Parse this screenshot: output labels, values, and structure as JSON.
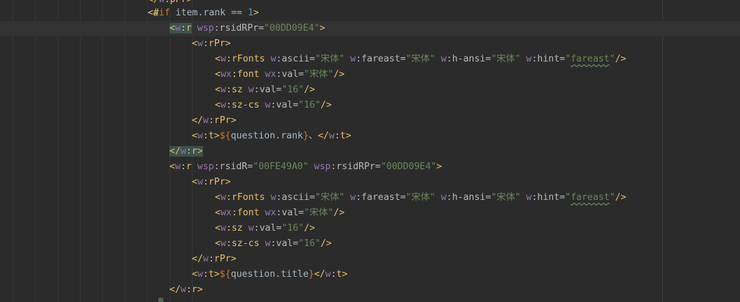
{
  "editor": {
    "lines": [
      {
        "tokens": [
          {
            "t": "</",
            "k": "tag"
          },
          {
            "t": "w",
            "k": "ns"
          },
          {
            "t": ":pPr>",
            "k": "tag"
          }
        ]
      },
      {
        "tokens": [
          {
            "t": "<#",
            "k": "tag"
          },
          {
            "t": "if",
            "k": "kw"
          },
          {
            "t": " item.rank == ",
            "k": "expr"
          },
          {
            "t": "1",
            "k": "num"
          },
          {
            "t": ">",
            "k": "tag"
          }
        ]
      },
      {
        "current": true,
        "tokens": [
          {
            "t": "<",
            "k": "tag",
            "hl": true
          },
          {
            "t": "w",
            "k": "ns",
            "hl": true
          },
          {
            "t": ":r",
            "k": "tag",
            "hl": true
          },
          {
            "t": " ",
            "k": "text"
          },
          {
            "t": "wsp",
            "k": "ns"
          },
          {
            "t": ":rsidRPr=",
            "k": "attr"
          },
          {
            "t": "\"00DD09E4\"",
            "k": "str"
          },
          {
            "t": ">",
            "k": "tag"
          }
        ]
      },
      {
        "tokens": [
          {
            "t": "<",
            "k": "tag"
          },
          {
            "t": "w",
            "k": "ns"
          },
          {
            "t": ":rPr>",
            "k": "tag"
          }
        ]
      },
      {
        "tokens": [
          {
            "t": "<",
            "k": "tag"
          },
          {
            "t": "w",
            "k": "ns"
          },
          {
            "t": ":rFonts",
            "k": "tag"
          },
          {
            "t": " ",
            "k": "text"
          },
          {
            "t": "w",
            "k": "ns"
          },
          {
            "t": ":ascii=",
            "k": "attr"
          },
          {
            "t": "\"宋体\"",
            "k": "str"
          },
          {
            "t": " ",
            "k": "text"
          },
          {
            "t": "w",
            "k": "ns"
          },
          {
            "t": ":fareast=",
            "k": "attr"
          },
          {
            "t": "\"宋体\"",
            "k": "str"
          },
          {
            "t": " ",
            "k": "text"
          },
          {
            "t": "w",
            "k": "ns"
          },
          {
            "t": ":h-ansi=",
            "k": "attr"
          },
          {
            "t": "\"宋体\"",
            "k": "str"
          },
          {
            "t": " ",
            "k": "text"
          },
          {
            "t": "w",
            "k": "ns"
          },
          {
            "t": ":hint=",
            "k": "attr"
          },
          {
            "t": "\"",
            "k": "str"
          },
          {
            "t": "fareast",
            "k": "str",
            "sq": true
          },
          {
            "t": "\"",
            "k": "str"
          },
          {
            "t": "/>",
            "k": "tag"
          }
        ]
      },
      {
        "tokens": [
          {
            "t": "<",
            "k": "tag"
          },
          {
            "t": "wx",
            "k": "ns"
          },
          {
            "t": ":font",
            "k": "tag"
          },
          {
            "t": " ",
            "k": "text"
          },
          {
            "t": "wx",
            "k": "ns"
          },
          {
            "t": ":val=",
            "k": "attr"
          },
          {
            "t": "\"宋体\"",
            "k": "str"
          },
          {
            "t": "/>",
            "k": "tag"
          }
        ]
      },
      {
        "tokens": [
          {
            "t": "<",
            "k": "tag"
          },
          {
            "t": "w",
            "k": "ns"
          },
          {
            "t": ":sz",
            "k": "tag"
          },
          {
            "t": " ",
            "k": "text"
          },
          {
            "t": "w",
            "k": "ns"
          },
          {
            "t": ":val=",
            "k": "attr"
          },
          {
            "t": "\"16\"",
            "k": "str"
          },
          {
            "t": "/>",
            "k": "tag"
          }
        ]
      },
      {
        "tokens": [
          {
            "t": "<",
            "k": "tag"
          },
          {
            "t": "w",
            "k": "ns"
          },
          {
            "t": ":sz-cs",
            "k": "tag"
          },
          {
            "t": " ",
            "k": "text"
          },
          {
            "t": "w",
            "k": "ns"
          },
          {
            "t": ":val=",
            "k": "attr"
          },
          {
            "t": "\"16\"",
            "k": "str"
          },
          {
            "t": "/>",
            "k": "tag"
          }
        ]
      },
      {
        "tokens": [
          {
            "t": "</",
            "k": "tag"
          },
          {
            "t": "w",
            "k": "ns"
          },
          {
            "t": ":rPr>",
            "k": "tag"
          }
        ]
      },
      {
        "tokens": [
          {
            "t": "<",
            "k": "tag"
          },
          {
            "t": "w",
            "k": "ns"
          },
          {
            "t": ":t>",
            "k": "tag"
          },
          {
            "t": "${",
            "k": "dollar"
          },
          {
            "t": "question.rank",
            "k": "expr"
          },
          {
            "t": "}",
            "k": "dollar"
          },
          {
            "t": "、",
            "k": "text"
          },
          {
            "t": "</",
            "k": "tag"
          },
          {
            "t": "w",
            "k": "ns"
          },
          {
            "t": ":t>",
            "k": "tag"
          }
        ]
      },
      {
        "tokens": [
          {
            "t": "</",
            "k": "tag",
            "hl": true
          },
          {
            "t": "w",
            "k": "ns",
            "hl": true
          },
          {
            "t": ":r>",
            "k": "tag",
            "hl": true
          }
        ]
      },
      {
        "tokens": [
          {
            "t": "<",
            "k": "tag"
          },
          {
            "t": "w",
            "k": "ns"
          },
          {
            "t": ":r",
            "k": "tag"
          },
          {
            "t": " ",
            "k": "text"
          },
          {
            "t": "wsp",
            "k": "ns"
          },
          {
            "t": ":rsidR=",
            "k": "attr"
          },
          {
            "t": "\"00FE49A0\"",
            "k": "str"
          },
          {
            "t": " ",
            "k": "text"
          },
          {
            "t": "wsp",
            "k": "ns"
          },
          {
            "t": ":rsidRPr=",
            "k": "attr"
          },
          {
            "t": "\"00DD09E4\"",
            "k": "str"
          },
          {
            "t": ">",
            "k": "tag"
          }
        ]
      },
      {
        "tokens": [
          {
            "t": "<",
            "k": "tag"
          },
          {
            "t": "w",
            "k": "ns"
          },
          {
            "t": ":rPr>",
            "k": "tag"
          }
        ]
      },
      {
        "tokens": [
          {
            "t": "<",
            "k": "tag"
          },
          {
            "t": "w",
            "k": "ns"
          },
          {
            "t": ":rFonts",
            "k": "tag"
          },
          {
            "t": " ",
            "k": "text"
          },
          {
            "t": "w",
            "k": "ns"
          },
          {
            "t": ":ascii=",
            "k": "attr"
          },
          {
            "t": "\"宋体\"",
            "k": "str"
          },
          {
            "t": " ",
            "k": "text"
          },
          {
            "t": "w",
            "k": "ns"
          },
          {
            "t": ":fareast=",
            "k": "attr"
          },
          {
            "t": "\"宋体\"",
            "k": "str"
          },
          {
            "t": " ",
            "k": "text"
          },
          {
            "t": "w",
            "k": "ns"
          },
          {
            "t": ":h-ansi=",
            "k": "attr"
          },
          {
            "t": "\"宋体\"",
            "k": "str"
          },
          {
            "t": " ",
            "k": "text"
          },
          {
            "t": "w",
            "k": "ns"
          },
          {
            "t": ":hint=",
            "k": "attr"
          },
          {
            "t": "\"",
            "k": "str"
          },
          {
            "t": "fareast",
            "k": "str",
            "sq": true
          },
          {
            "t": "\"",
            "k": "str"
          },
          {
            "t": "/>",
            "k": "tag"
          }
        ]
      },
      {
        "tokens": [
          {
            "t": "<",
            "k": "tag"
          },
          {
            "t": "wx",
            "k": "ns"
          },
          {
            "t": ":font",
            "k": "tag"
          },
          {
            "t": " ",
            "k": "text"
          },
          {
            "t": "wx",
            "k": "ns"
          },
          {
            "t": ":val=",
            "k": "attr"
          },
          {
            "t": "\"宋体\"",
            "k": "str"
          },
          {
            "t": "/>",
            "k": "tag"
          }
        ]
      },
      {
        "tokens": [
          {
            "t": "<",
            "k": "tag"
          },
          {
            "t": "w",
            "k": "ns"
          },
          {
            "t": ":sz",
            "k": "tag"
          },
          {
            "t": " ",
            "k": "text"
          },
          {
            "t": "w",
            "k": "ns"
          },
          {
            "t": ":val=",
            "k": "attr"
          },
          {
            "t": "\"16\"",
            "k": "str"
          },
          {
            "t": "/>",
            "k": "tag"
          }
        ]
      },
      {
        "tokens": [
          {
            "t": "<",
            "k": "tag"
          },
          {
            "t": "w",
            "k": "ns"
          },
          {
            "t": ":sz-cs",
            "k": "tag"
          },
          {
            "t": " ",
            "k": "text"
          },
          {
            "t": "w",
            "k": "ns"
          },
          {
            "t": ":val=",
            "k": "attr"
          },
          {
            "t": "\"16\"",
            "k": "str"
          },
          {
            "t": "/>",
            "k": "tag"
          }
        ]
      },
      {
        "tokens": [
          {
            "t": "</",
            "k": "tag"
          },
          {
            "t": "w",
            "k": "ns"
          },
          {
            "t": ":rPr>",
            "k": "tag"
          }
        ]
      },
      {
        "tokens": [
          {
            "t": "<",
            "k": "tag"
          },
          {
            "t": "w",
            "k": "ns"
          },
          {
            "t": ":t>",
            "k": "tag"
          },
          {
            "t": "${",
            "k": "dollar"
          },
          {
            "t": "question.title",
            "k": "expr"
          },
          {
            "t": "}",
            "k": "dollar"
          },
          {
            "t": "</",
            "k": "tag"
          },
          {
            "t": "w",
            "k": "ns"
          },
          {
            "t": ":t>",
            "k": "tag"
          }
        ]
      },
      {
        "tokens": [
          {
            "t": "</",
            "k": "tag"
          },
          {
            "t": "w",
            "k": "ns"
          },
          {
            "t": ":r>",
            "k": "tag"
          }
        ]
      }
    ]
  },
  "colors": {
    "background": "#2b2b2b",
    "current_line": "#323232",
    "tag": "#e8bf6a",
    "namespace": "#9876aa",
    "attribute": "#bababa",
    "string": "#6a8759",
    "keyword": "#cc7832",
    "number": "#6897bb",
    "text": "#a9b7c6"
  }
}
